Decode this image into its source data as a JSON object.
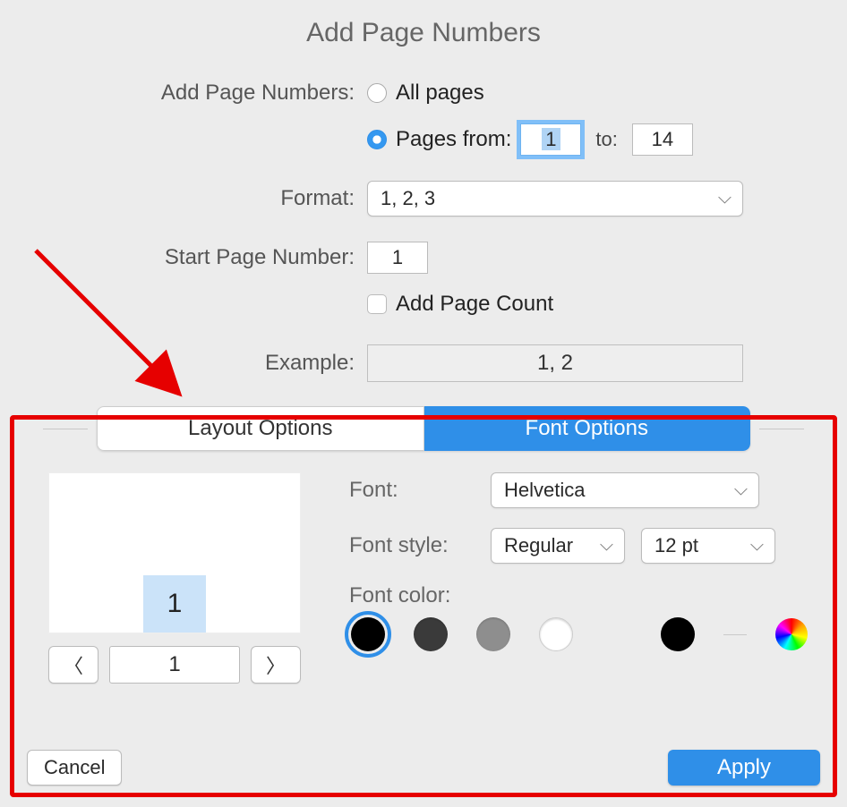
{
  "dialog": {
    "title": "Add Page Numbers",
    "labels": {
      "add_page_numbers": "Add Page Numbers:",
      "format": "Format:",
      "start_page_number": "Start Page Number:",
      "add_page_count": "Add Page Count",
      "example": "Example:"
    },
    "radio": {
      "all_pages": "All pages",
      "pages_from": "Pages from:",
      "to": "to:",
      "selected": "pages_from",
      "from_value": "1",
      "to_value": "14"
    },
    "format_value": "1, 2, 3",
    "start_value": "1",
    "add_page_count_checked": false,
    "example_value": "1, 2"
  },
  "tabs": {
    "layout": "Layout Options",
    "font": "Font Options",
    "active": "font"
  },
  "font_panel": {
    "preview_number": "1",
    "pager_value": "1",
    "labels": {
      "font": "Font:",
      "font_style": "Font style:",
      "font_color": "Font color:"
    },
    "font_value": "Helvetica",
    "style_value": "Regular",
    "size_value": "12 pt",
    "selected_color": "black"
  },
  "footer": {
    "cancel": "Cancel",
    "apply": "Apply"
  }
}
